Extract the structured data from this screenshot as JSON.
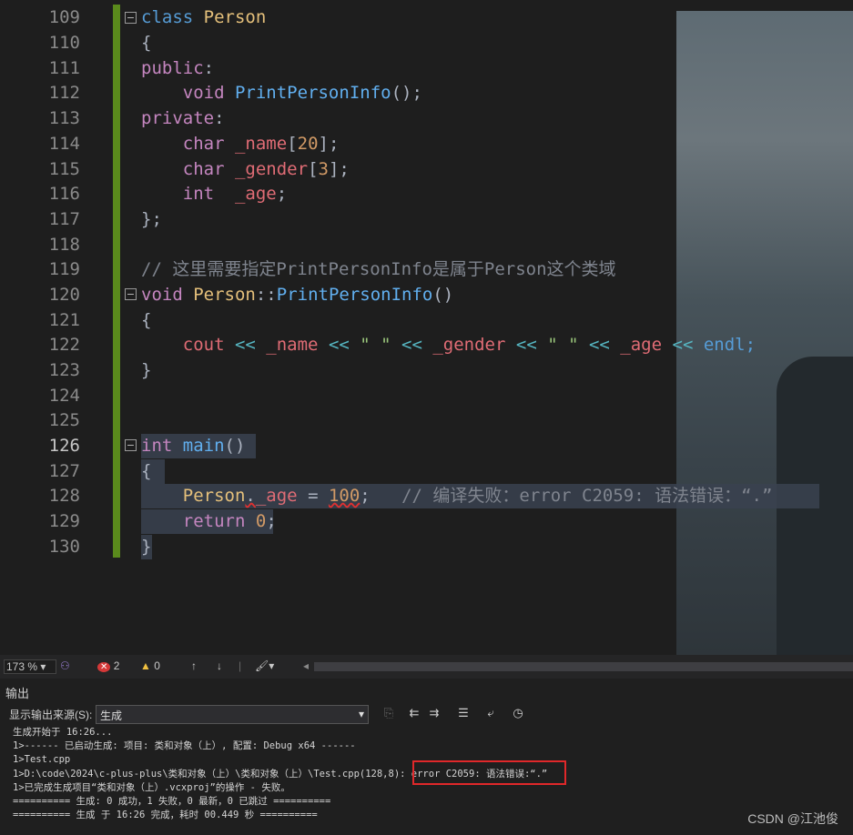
{
  "editor": {
    "lines": [
      {
        "n": "109"
      },
      {
        "n": "110"
      },
      {
        "n": "111"
      },
      {
        "n": "112"
      },
      {
        "n": "113"
      },
      {
        "n": "114"
      },
      {
        "n": "115"
      },
      {
        "n": "116"
      },
      {
        "n": "117"
      },
      {
        "n": "118"
      },
      {
        "n": "119"
      },
      {
        "n": "120"
      },
      {
        "n": "121"
      },
      {
        "n": "122"
      },
      {
        "n": "123"
      },
      {
        "n": "124"
      },
      {
        "n": "125"
      },
      {
        "n": "126"
      },
      {
        "n": "127"
      },
      {
        "n": "128"
      },
      {
        "n": "129"
      },
      {
        "n": "130"
      }
    ],
    "code": {
      "l109_kw": "class",
      "l109_name": "Person",
      "l110": "{",
      "l111_kw": "public",
      "l111_c": ":",
      "l112_kw": "void",
      "l112_fn": "PrintPersonInfo",
      "l112_p": "();",
      "l113_kw": "private",
      "l113_c": ":",
      "l114_kw": "char",
      "l114_v": "_name",
      "l114_b1": "[",
      "l114_num": "20",
      "l114_b2": "];",
      "l115_kw": "char",
      "l115_v": "_gender",
      "l115_b1": "[",
      "l115_num": "3",
      "l115_b2": "];",
      "l116_kw": "int",
      "l116_v": "_age",
      "l116_p": ";",
      "l117": "};",
      "l119": "// 这里需要指定PrintPersonInfo是属于Person这个类域",
      "l120_kw": "void",
      "l120_cls": "Person",
      "l120_op": "::",
      "l120_fn": "PrintPersonInfo",
      "l120_p": "()",
      "l121": "{",
      "l122_v1": "cout",
      "l122_o1": " << ",
      "l122_v2": "_name",
      "l122_o2": " << ",
      "l122_s1": "\" \"",
      "l122_o3": " << ",
      "l122_v3": "_gender",
      "l122_o4": " << ",
      "l122_s2": "\" \"",
      "l122_o5": " << ",
      "l122_v4": "_age",
      "l122_o6": " << ",
      "l122_v5": "endl;",
      "l123": "}",
      "l126_kw": "int",
      "l126_fn": "main",
      "l126_p": "()",
      "l127": "{",
      "l128_cls": "Person",
      "l128_d": ".",
      "l128_v": "_age",
      "l128_eq": " = ",
      "l128_num": "100",
      "l128_p": ";",
      "l128_cm": "// 编译失败：error C2059: 语法错误：“.”",
      "l129_kw": "return",
      "l129_num": "0",
      "l129_p": ";",
      "l130": "}"
    }
  },
  "statusbar": {
    "zoom": "173 %",
    "errors": "2",
    "warnings": "0"
  },
  "output": {
    "title": "输出",
    "source_label": "显示输出来源(S):",
    "source_value": "生成",
    "lines": [
      "生成开始于 16:26...",
      "1>------ 已启动生成: 项目: 类和对象（上）, 配置: Debug x64 ------",
      "1>Test.cpp",
      "1>D:\\code\\2024\\c-plus-plus\\类和对象（上）\\类和对象（上）\\Test.cpp(128,8): error C2059: 语法错误:“.”",
      "1>已完成生成项目“类和对象（上）.vcxproj”的操作 - 失败。",
      "========== 生成: 0 成功，1 失败，0 最新，0 已跳过 ==========",
      "========== 生成 于 16:26 完成，耗时 00.449 秒 =========="
    ]
  },
  "watermark": "CSDN @江池俊",
  "colors": {
    "gutter_change": "#5a8a1c",
    "error_box": "#e0282a",
    "keyword": "#c586c0",
    "type_keyword": "#569cd6"
  }
}
